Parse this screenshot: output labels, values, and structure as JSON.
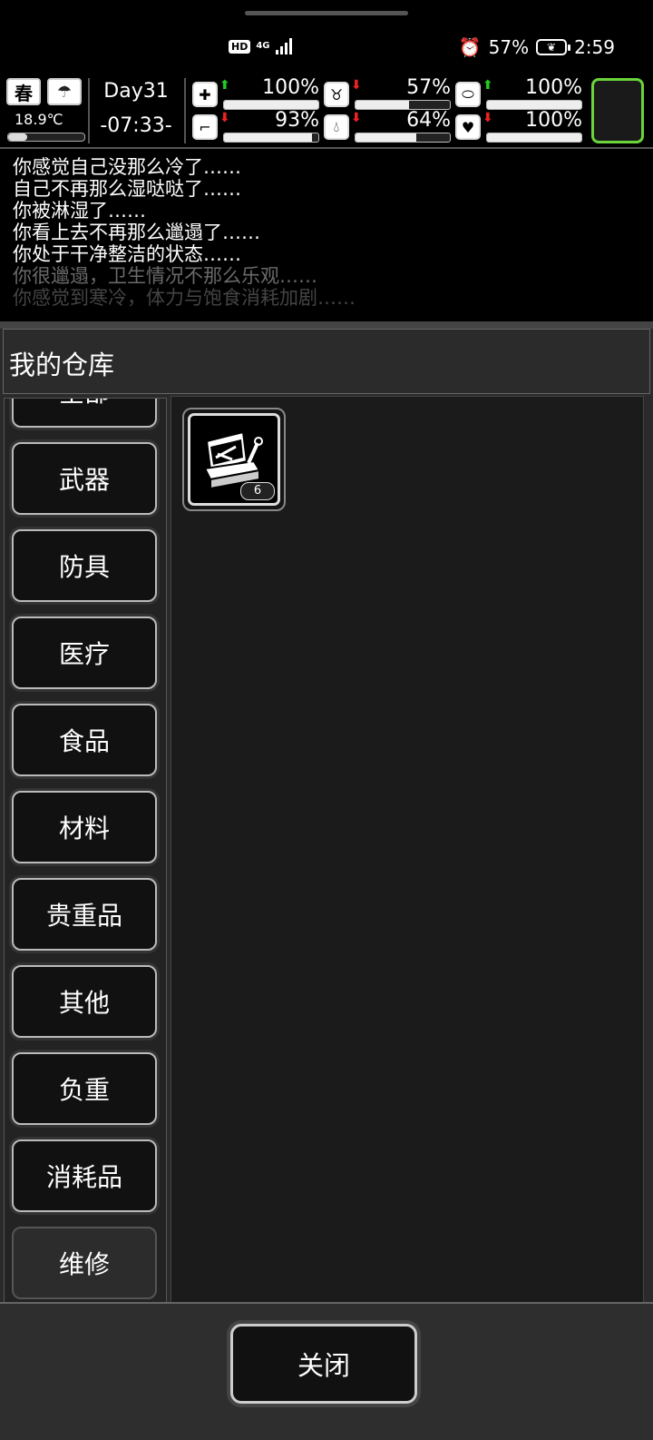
{
  "status_bar": {
    "hd": "HD",
    "network": "4G",
    "battery_percent": "57%",
    "time": "2:59",
    "icons": [
      "alarm-icon",
      "battery-saver-leaf-icon"
    ]
  },
  "hud": {
    "season": "春",
    "weather_icon": "rain-cloud-icon",
    "temperature": "18.9℃",
    "day": "Day31",
    "clock": "-07:33-",
    "stats": [
      {
        "name": "health",
        "icon": "medkit-icon",
        "trend": "up",
        "value": "100%",
        "level": 1.0
      },
      {
        "name": "hunger",
        "icon": "stomach-icon",
        "trend": "down",
        "value": "57%",
        "level": 0.57
      },
      {
        "name": "medicine",
        "icon": "pill-icon",
        "trend": "up",
        "value": "100%",
        "level": 1.0
      },
      {
        "name": "stamina",
        "icon": "boot-icon",
        "trend": "down",
        "value": "93%",
        "level": 0.93
      },
      {
        "name": "thirst",
        "icon": "water-drop-icon",
        "trend": "down",
        "value": "64%",
        "level": 0.64
      },
      {
        "name": "mood",
        "icon": "heart-icon",
        "trend": "down",
        "value": "100%",
        "level": 1.0
      }
    ]
  },
  "log": [
    "你感觉自己没那么冷了……",
    "自己不再那么湿哒哒了……",
    "你被淋湿了……",
    "你看上去不再那么邋遢了……",
    "你处于干净整洁的状态……",
    "你很邋遢，卫生情况不那么乐观……",
    "你感觉到寒冷，体力与饱食消耗加剧……"
  ],
  "warehouse": {
    "title": "我的仓库",
    "categories": [
      "全部",
      "武器",
      "防具",
      "医疗",
      "食品",
      "材料",
      "贵重品",
      "其他",
      "负重",
      "消耗品",
      "维修"
    ],
    "active_category": "维修",
    "items": [
      {
        "icon": "repair-toolbox-icon",
        "quantity": "6"
      }
    ],
    "close_label": "关闭"
  },
  "colors": {
    "accent_green": "#6ad43a",
    "trend_up": "#22cc22",
    "trend_down": "#ee2222"
  }
}
